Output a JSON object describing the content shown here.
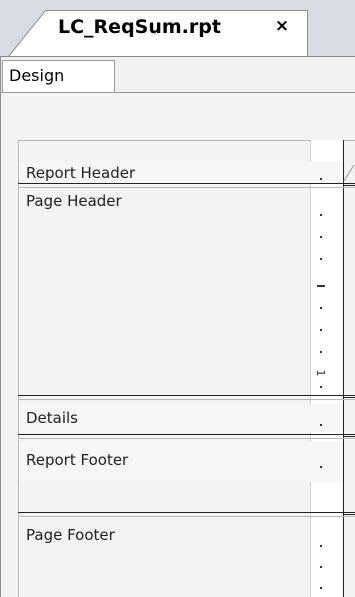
{
  "document_tab": {
    "title": "LC_ReqSum.rpt",
    "close_glyph": "×"
  },
  "view_tabs": {
    "design_label": "Design"
  },
  "sections": [
    {
      "label": "Report Header"
    },
    {
      "label": "Page Header"
    },
    {
      "label": "Details"
    },
    {
      "label": "Report Footer"
    },
    {
      "label": "Page Footer"
    }
  ],
  "vertical_ruler": {
    "marker_label": "1"
  },
  "colors": {
    "tab_strip": "#d7dce4",
    "panel_background": "#f3f3f3",
    "section_rule": "#222222",
    "border": "#8c8c8c"
  }
}
